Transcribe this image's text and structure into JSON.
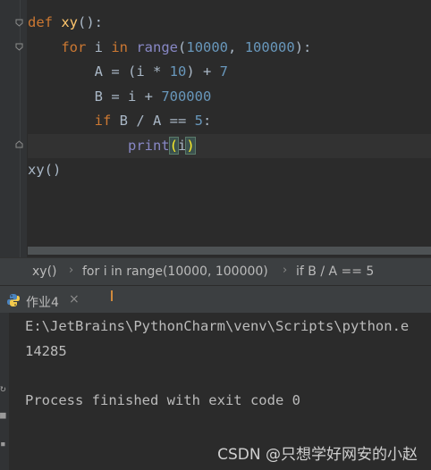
{
  "editor": {
    "line1": {
      "def": "def",
      "name": "xy",
      "rest": "():"
    },
    "line2": {
      "for": "for",
      "var": " i ",
      "in": "in",
      "range": "range",
      "open": "(",
      "n1": "10000",
      "comma": ", ",
      "n2": "100000",
      "close": "):"
    },
    "line3": {
      "lhs": "A = (i * ",
      "n1": "10",
      "mid": ") + ",
      "n2": "7"
    },
    "line4": {
      "lhs": "B = i + ",
      "n1": "700000"
    },
    "line5": {
      "if": "if",
      "mid": " B / A == ",
      "n1": "5",
      "end": ":"
    },
    "line6": {
      "print": "print",
      "open": "(",
      "arg": "i",
      "close": ")"
    },
    "line7": {
      "call": "xy()"
    }
  },
  "breadcrumbs": {
    "items": [
      "xy()",
      "for i in range(10000, 100000)",
      "if B / A == 5"
    ],
    "sep": "›"
  },
  "run_tab": {
    "label": "作业4",
    "close": "×"
  },
  "console": {
    "cmd": "E:\\JetBrains\\PythonCharm\\venv\\Scripts\\python.e",
    "output": "14285",
    "exit": "Process finished with exit code 0"
  },
  "watermark": "CSDN @只想学好网安的小赵",
  "colors": {
    "keyword": "#cc7832",
    "function": "#ffc66d",
    "number": "#6897bb",
    "builtin": "#8888c6",
    "text": "#a9b7c6",
    "background": "#2b2b2b"
  }
}
